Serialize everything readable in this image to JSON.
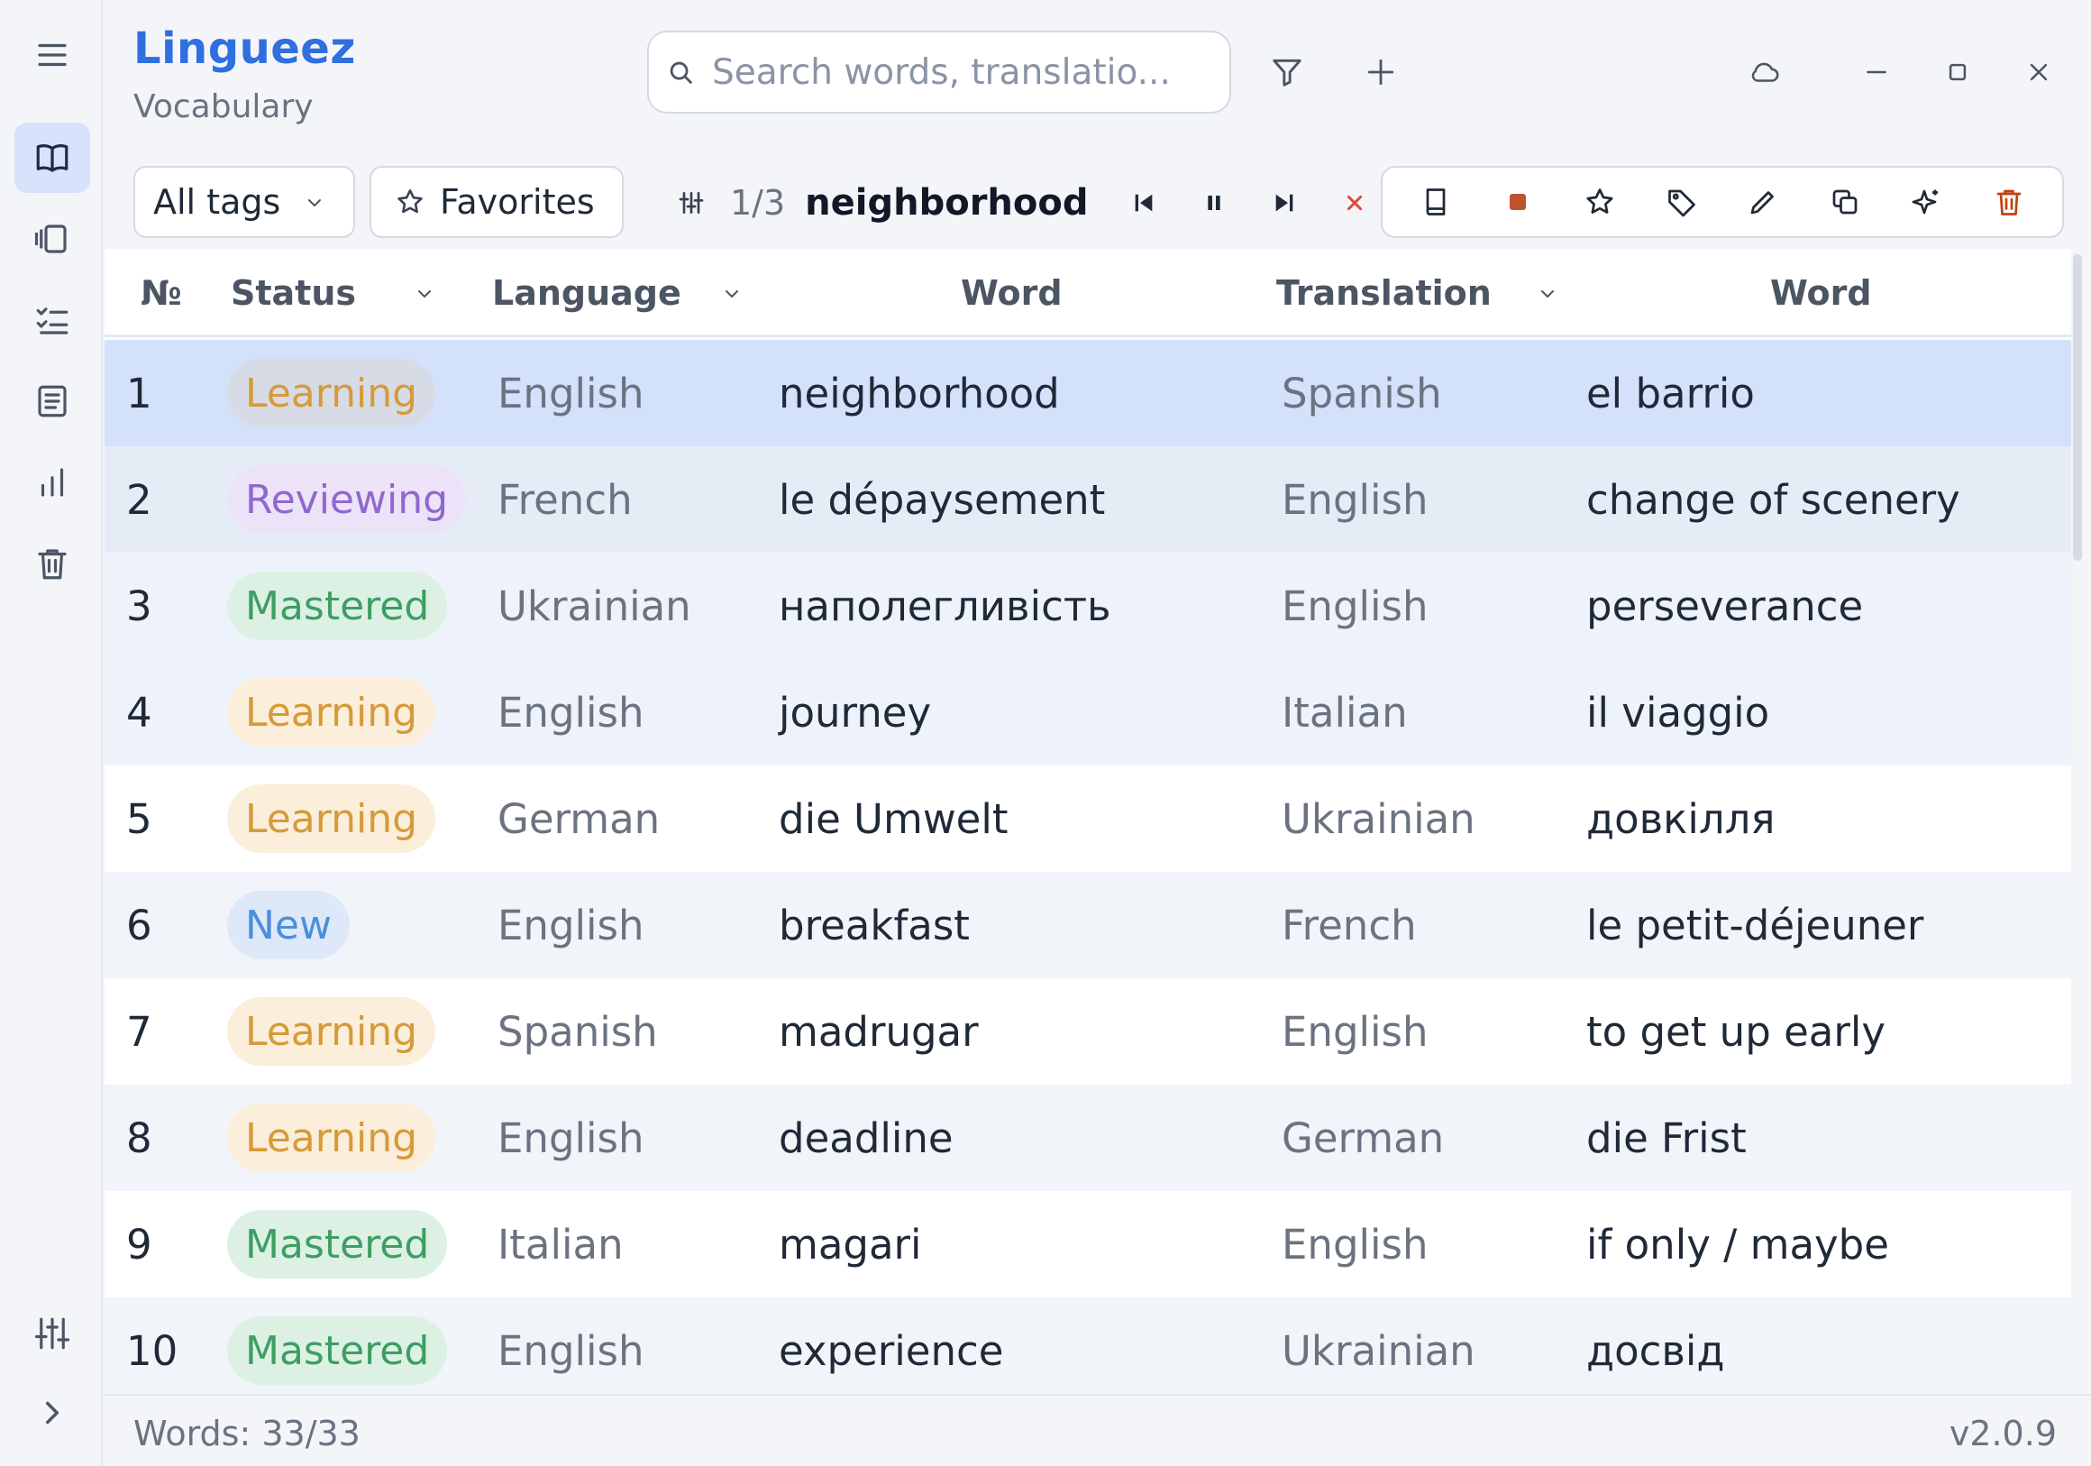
{
  "app": {
    "title": "Lingueez",
    "subtitle": "Vocabulary"
  },
  "search": {
    "placeholder": "Search words, translatio..."
  },
  "toolbar": {
    "tags_label": "All tags",
    "favorites_label": "Favorites"
  },
  "player": {
    "position": "1/3",
    "current_word": "neighborhood"
  },
  "colors": {
    "accent": "#2f6fde",
    "selected_row": "#d3e1fb",
    "delete": "#c2410c",
    "stop": "#c0532f",
    "close": "#dc4b3a"
  },
  "icons": {
    "rail": [
      "menu-icon",
      "book-icon",
      "cards-icon",
      "checklist-icon",
      "document-icon",
      "chart-icon",
      "trash-icon",
      "sliders-icon",
      "chevron-right-icon"
    ],
    "header": [
      "search-icon",
      "filter-icon",
      "plus-icon",
      "cloud-icon",
      "minimize-icon",
      "maximize-icon",
      "close-icon"
    ],
    "actions": [
      "book-icon",
      "stop-icon",
      "star-icon",
      "tag-icon",
      "pencil-icon",
      "copy-icon",
      "sparkle-icon",
      "trash-icon"
    ]
  },
  "table": {
    "headers": {
      "num": "№",
      "status": "Status",
      "language": "Language",
      "word": "Word",
      "translation": "Translation",
      "translation_word": "Word"
    },
    "rows": [
      {
        "num": "1",
        "status": "Learning",
        "language": "English",
        "word": "neighborhood",
        "translation_language": "Spanish",
        "translation": "el barrio"
      },
      {
        "num": "2",
        "status": "Reviewing",
        "language": "French",
        "word": "le dépaysement",
        "translation_language": "English",
        "translation": "change of scenery"
      },
      {
        "num": "3",
        "status": "Mastered",
        "language": "Ukrainian",
        "word": "наполегливість",
        "translation_language": "English",
        "translation": "perseverance"
      },
      {
        "num": "4",
        "status": "Learning",
        "language": "English",
        "word": "journey",
        "translation_language": "Italian",
        "translation": "il viaggio"
      },
      {
        "num": "5",
        "status": "Learning",
        "language": "German",
        "word": "die Umwelt",
        "translation_language": "Ukrainian",
        "translation": "довкілля"
      },
      {
        "num": "6",
        "status": "New",
        "language": "English",
        "word": "breakfast",
        "translation_language": "French",
        "translation": "le petit-déjeuner"
      },
      {
        "num": "7",
        "status": "Learning",
        "language": "Spanish",
        "word": "madrugar",
        "translation_language": "English",
        "translation": "to get up early"
      },
      {
        "num": "8",
        "status": "Learning",
        "language": "English",
        "word": "deadline",
        "translation_language": "German",
        "translation": "die Frist"
      },
      {
        "num": "9",
        "status": "Mastered",
        "language": "Italian",
        "word": "magari",
        "translation_language": "English",
        "translation": "if only / maybe"
      },
      {
        "num": "10",
        "status": "Mastered",
        "language": "English",
        "word": "experience",
        "translation_language": "Ukrainian",
        "translation": "досвід"
      }
    ]
  },
  "status_colors": {
    "Learning": {
      "bg": "#fbeeda",
      "fg": "#d69a3a"
    },
    "Reviewing": {
      "bg": "#ece3f8",
      "fg": "#9067cf"
    },
    "Mastered": {
      "bg": "#dcf1e4",
      "fg": "#3e9e63"
    },
    "New": {
      "bg": "#dde9f8",
      "fg": "#4b8fdc"
    }
  },
  "footer": {
    "words": "Words: 33/33",
    "version": "v2.0.9"
  }
}
